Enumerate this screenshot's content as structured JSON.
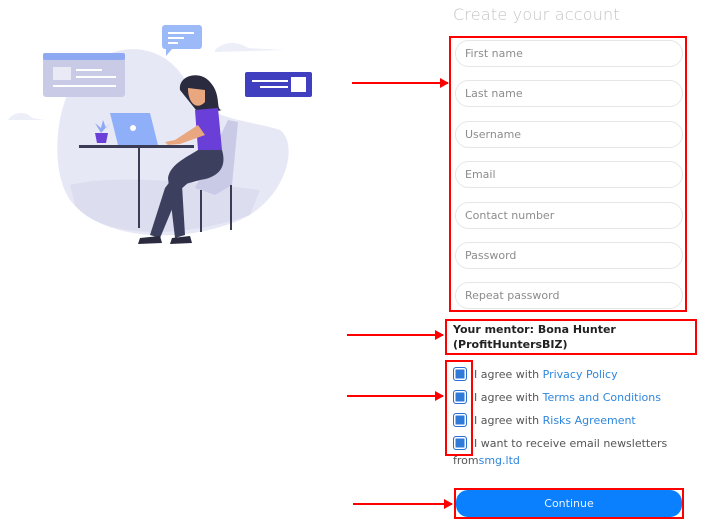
{
  "form": {
    "title": "Create your account",
    "fields": [
      {
        "name": "first-name",
        "placeholder": "First name",
        "value": ""
      },
      {
        "name": "last-name",
        "placeholder": "Last name",
        "value": ""
      },
      {
        "name": "username",
        "placeholder": "Username",
        "value": ""
      },
      {
        "name": "email",
        "placeholder": "Email",
        "value": ""
      },
      {
        "name": "contact-number",
        "placeholder": "Contact number",
        "value": ""
      },
      {
        "name": "password",
        "placeholder": "Password",
        "value": ""
      },
      {
        "name": "repeat-password",
        "placeholder": "Repeat password",
        "value": ""
      }
    ],
    "mentor_line1": "Your mentor: Bona Hunter",
    "mentor_line2": "(ProfitHuntersBIZ)",
    "agreements": [
      {
        "prefix": "I agree with ",
        "link": "Privacy Policy",
        "checked": true
      },
      {
        "prefix": "I agree with ",
        "link": "Terms and Conditions",
        "checked": true
      },
      {
        "prefix": "I agree with ",
        "link": "Risks Agreement",
        "checked": true
      },
      {
        "prefix": "I want to receive email newsletters",
        "prefix2": "from ",
        "link": "smg.ltd",
        "checked": true
      }
    ],
    "continue_label": "Continue"
  },
  "illustration": {
    "description": "woman working on laptop at desk",
    "accent": "#5b45e0"
  },
  "annotations": {
    "highlight_color": "#ff0000"
  }
}
